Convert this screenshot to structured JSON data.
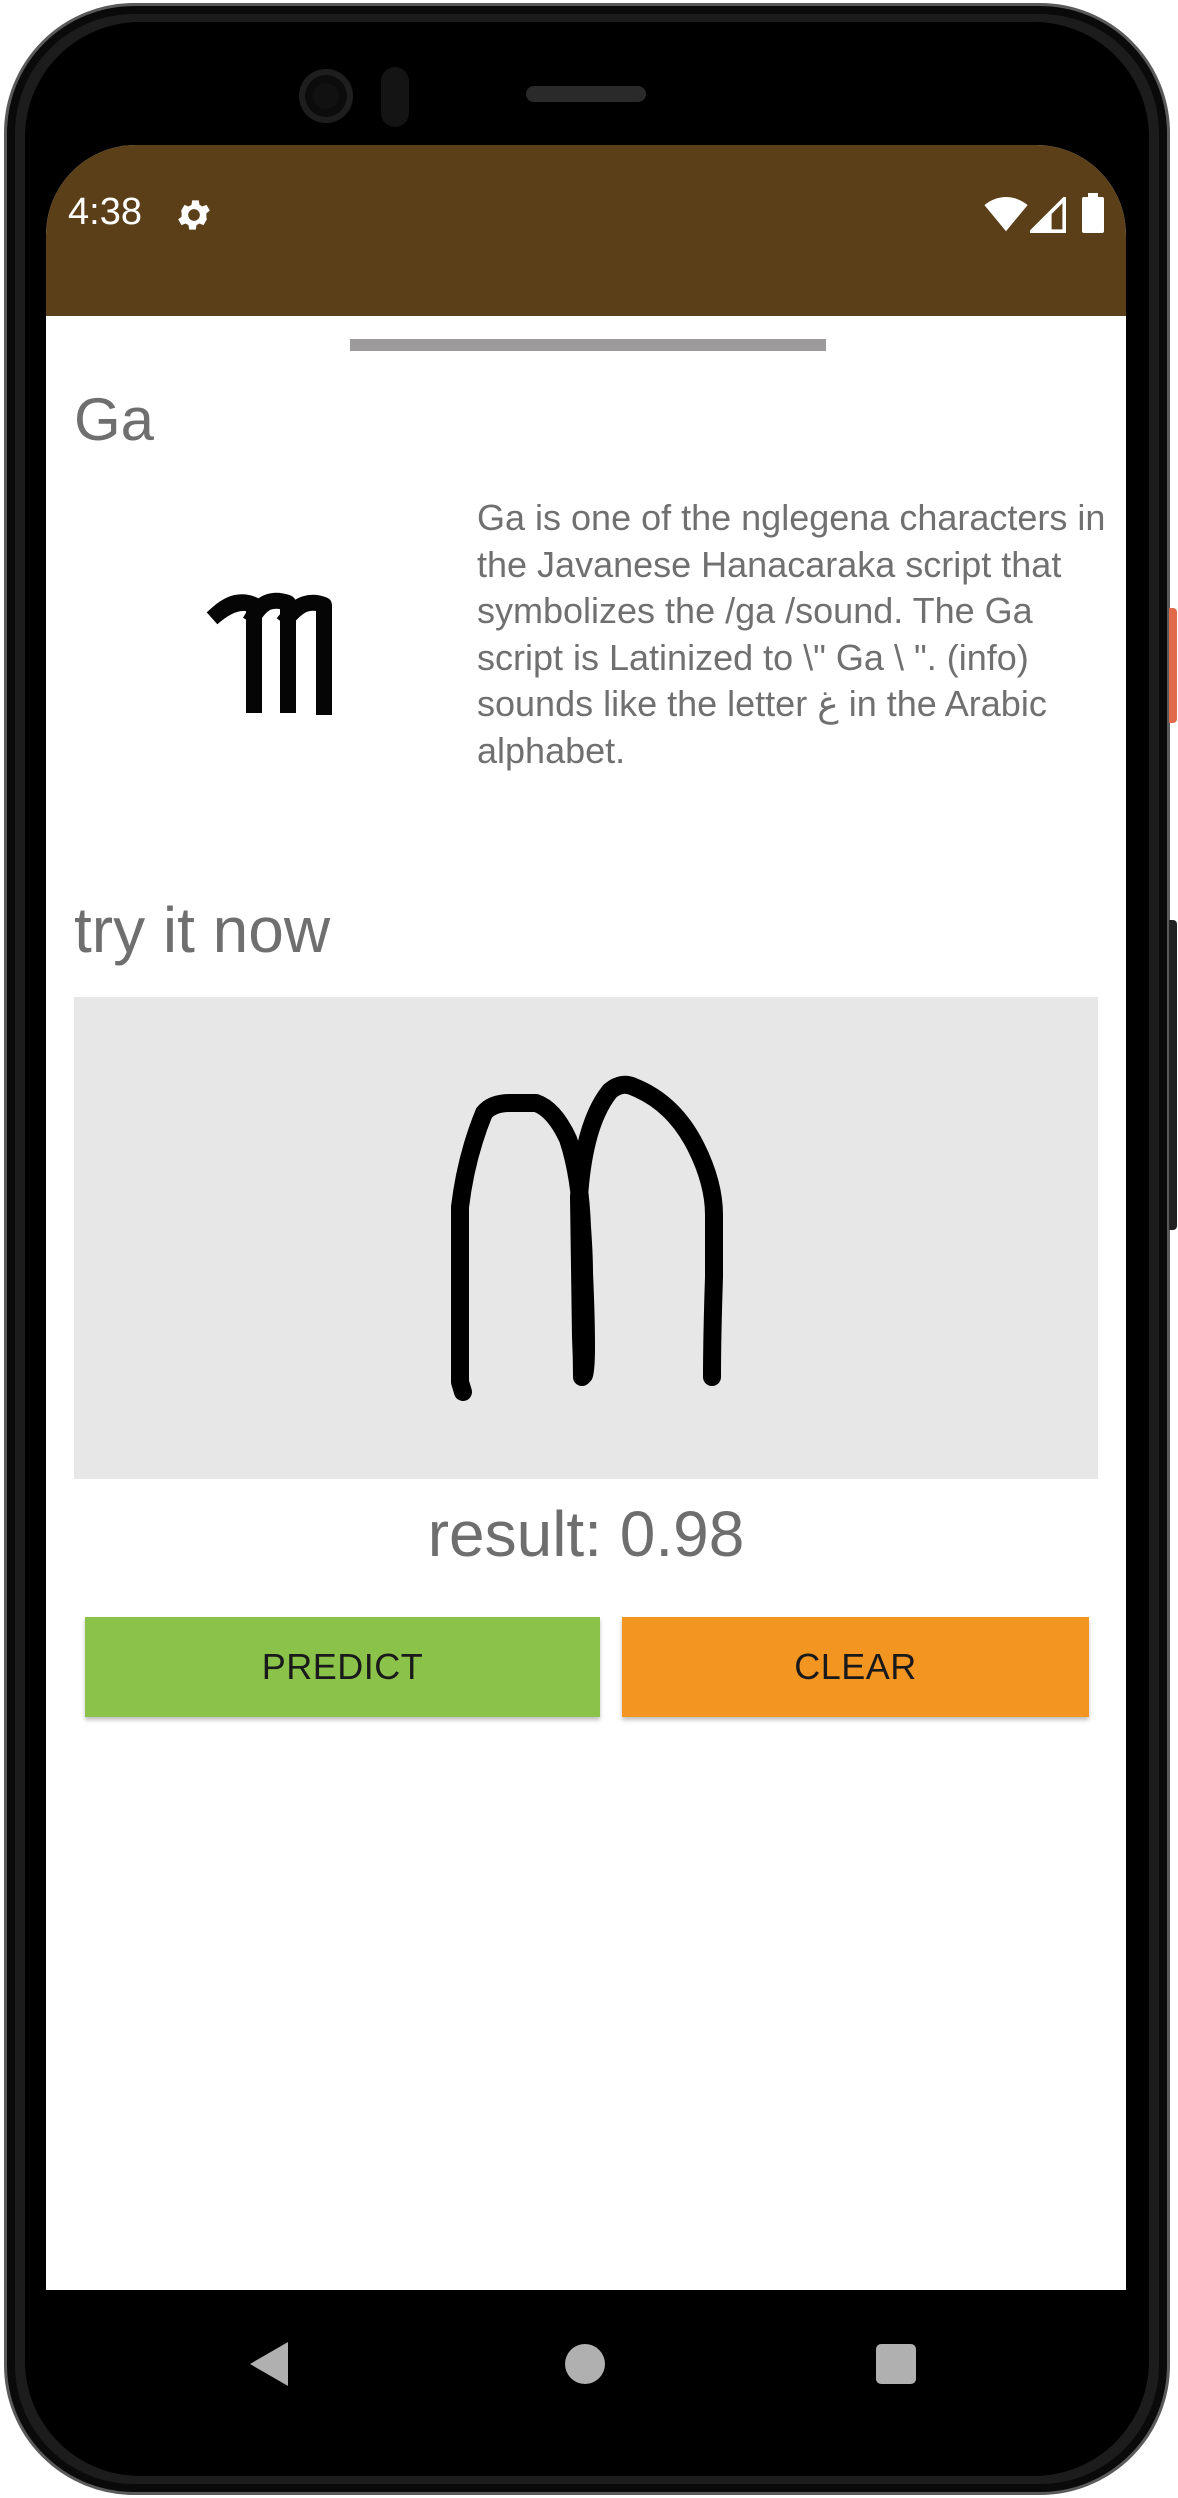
{
  "status_bar": {
    "time": "4:38",
    "icons": [
      "gear-icon",
      "wifi-icon",
      "signal-icon",
      "battery-icon"
    ],
    "background_color": "#5b3f18"
  },
  "character": {
    "name": "Ga",
    "glyph": "ꦒ",
    "description": "Ga is one of the nglegena characters in the Javanese Hanacaraka script that symbolizes the /ga /sound. The Ga script is Latinized to \\\" Ga \\ \". (info) sounds like the letter غ in the Arabic alphabet."
  },
  "practice": {
    "title": "try it now",
    "result_text": "result: 0.98"
  },
  "buttons": {
    "predict_label": "PREDICT",
    "clear_label": "CLEAR",
    "predict_color": "#8bc34a",
    "clear_color": "#f29621"
  },
  "nav_bar": {
    "icons": [
      "back-icon",
      "home-icon",
      "recents-icon"
    ]
  }
}
